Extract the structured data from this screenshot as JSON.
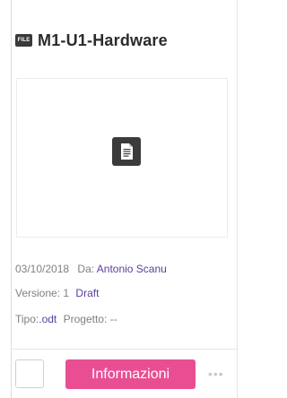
{
  "file": {
    "badge": "FILE",
    "title": "M1-U1-Hardware"
  },
  "meta": {
    "date": "03/10/2018",
    "author_label": "Da:",
    "author": "Antonio Scanu",
    "version_label": "Versione:",
    "version": "1",
    "status": "Draft",
    "type_label": "Tipo:",
    "type": ".odt",
    "project_label": "Progetto:",
    "project": "--"
  },
  "actions": {
    "info_label": "Informazioni",
    "more_label": "•••"
  },
  "colors": {
    "accent": "#e94e93",
    "link": "#5a3f9a"
  }
}
